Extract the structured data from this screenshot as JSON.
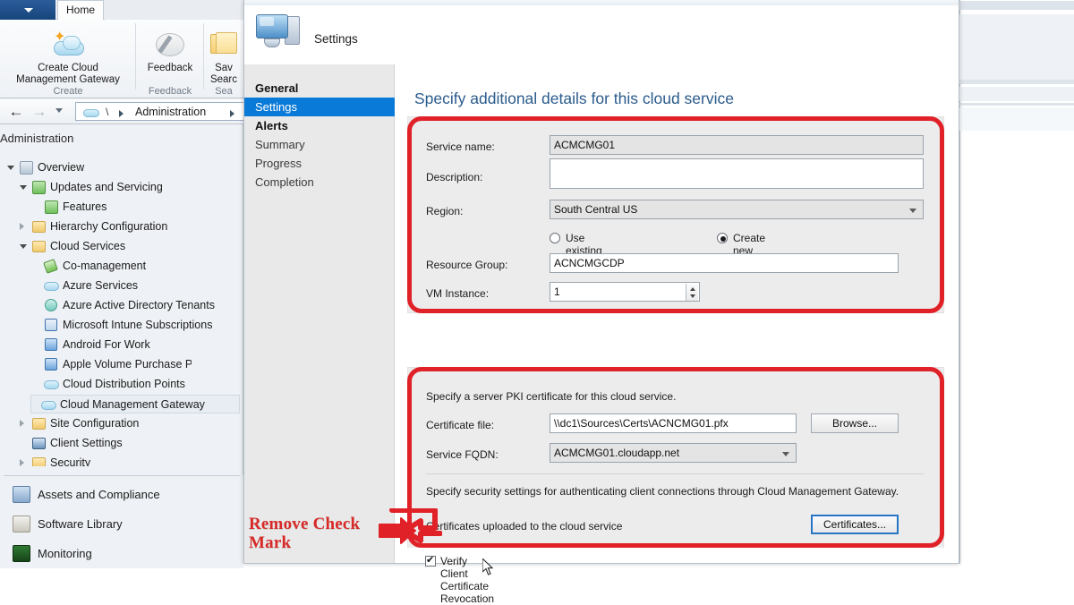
{
  "app": {
    "ribbon": {
      "tab_home": "Home",
      "menu_icon": "ribbon-menu-caret",
      "groups": [
        {
          "caption": "Create Cloud\nManagement Gateway",
          "caption_line1": "Create Cloud",
          "caption_line2": "Management Gateway",
          "group_label": "Create",
          "icon": "cloud-star-icon"
        },
        {
          "caption_line1": "Feedback",
          "caption_line2": "",
          "group_label": "Feedback",
          "icon": "pencil-feedback-icon"
        },
        {
          "caption_line1": "Sav",
          "caption_line2": "Searc",
          "group_label": "Sea",
          "icon": "folder-save-search-icon"
        }
      ]
    },
    "navbar": {
      "back_icon": "back-arrow-icon",
      "forward_icon": "forward-arrow-icon",
      "history_icon": "history-dropdown-icon",
      "root_icon": "cloud-icon",
      "separator": "\\",
      "crumb": "Administration"
    },
    "tree": {
      "title": "Administration",
      "items": [
        {
          "label": "Overview",
          "indent": 0,
          "twisty": "open",
          "icon": "overview-icon"
        },
        {
          "label": "Updates and Servicing",
          "indent": 1,
          "twisty": "open",
          "icon": "updates-servicing-icon"
        },
        {
          "label": "Features",
          "indent": 2,
          "twisty": "none",
          "icon": "features-icon"
        },
        {
          "label": "Hierarchy Configuration",
          "indent": 1,
          "twisty": "closed",
          "icon": "folder-icon"
        },
        {
          "label": "Cloud Services",
          "indent": 1,
          "twisty": "open",
          "icon": "folder-icon"
        },
        {
          "label": "Co-management",
          "indent": 2,
          "twisty": "none",
          "icon": "co-management-icon"
        },
        {
          "label": "Azure Services",
          "indent": 2,
          "twisty": "none",
          "icon": "cloud-icon"
        },
        {
          "label": "Azure Active Directory Tenants",
          "indent": 2,
          "twisty": "none",
          "icon": "aad-tenants-icon"
        },
        {
          "label": "Microsoft Intune Subscriptions",
          "indent": 2,
          "twisty": "none",
          "icon": "intune-icon"
        },
        {
          "label": "Android For Work",
          "indent": 2,
          "twisty": "none",
          "icon": "android-for-work-icon"
        },
        {
          "label": "Apple Volume Purchase Program Tok",
          "indent": 2,
          "twisty": "none",
          "icon": "apple-vpp-icon"
        },
        {
          "label": "Cloud Distribution Points",
          "indent": 2,
          "twisty": "none",
          "icon": "cloud-icon"
        },
        {
          "label": "Cloud Management Gateway",
          "indent": 2,
          "twisty": "none",
          "icon": "cloud-icon",
          "selected": true
        },
        {
          "label": "Site Configuration",
          "indent": 1,
          "twisty": "closed",
          "icon": "folder-icon"
        },
        {
          "label": "Client Settings",
          "indent": 1,
          "twisty": "none",
          "icon": "client-settings-icon"
        },
        {
          "label": "Security",
          "indent": 1,
          "twisty": "closed",
          "icon": "folder-icon"
        }
      ]
    },
    "workspaces": [
      {
        "label": "Assets and Compliance",
        "icon": "assets-compliance-icon"
      },
      {
        "label": "Software Library",
        "icon": "software-library-icon"
      },
      {
        "label": "Monitoring",
        "icon": "monitoring-icon"
      }
    ]
  },
  "wizard": {
    "header_title": "Settings",
    "header_icon": "computer-settings-icon",
    "nav": [
      {
        "label": "General",
        "state": "done"
      },
      {
        "label": "Settings",
        "state": "selected"
      },
      {
        "label": "Alerts",
        "state": "done"
      },
      {
        "label": "Summary",
        "state": "future"
      },
      {
        "label": "Progress",
        "state": "future"
      },
      {
        "label": "Completion",
        "state": "future"
      }
    ],
    "page_heading": "Specify additional details for this cloud service",
    "service_section": {
      "service_name_label": "Service name:",
      "service_name_value": "ACMCMG01",
      "description_label": "Description:",
      "description_value": "",
      "region_label": "Region:",
      "region_value": "South Central US",
      "resource_group_mode_existing": "Use existing",
      "resource_group_mode_new": "Create new",
      "resource_group_selected": "Create new",
      "resource_group_label": "Resource Group:",
      "resource_group_value": "ACNCMGCDP",
      "vm_instance_label": "VM Instance:",
      "vm_instance_value": "1"
    },
    "cert_section": {
      "pki_text": "Specify a server PKI certificate for this cloud service.",
      "certificate_file_label": "Certificate file:",
      "certificate_file_value": "\\\\dc1\\Sources\\Certs\\ACNCMG01.pfx",
      "browse_label": "Browse...",
      "service_fqdn_label": "Service FQDN:",
      "service_fqdn_value": "ACMCMG01.cloudapp.net",
      "security_text": "Specify security settings for authenticating client connections through Cloud Management Gateway.",
      "uploaded_text": "Certificates uploaded to the cloud service",
      "certificates_button": "Certificates...",
      "verify_revocation_label": "Verify Client Certificate Revocation",
      "verify_revocation_checked": true
    }
  },
  "annotation": {
    "line1": "Remove Check",
    "line2": "Mark",
    "color": "#d72a27",
    "arrow_icon": "block-arrow-right-icon"
  },
  "colors": {
    "highlight_red": "#e02128",
    "wizard_select_blue": "#0a7ad8",
    "heading_blue": "#2a5b8c"
  }
}
